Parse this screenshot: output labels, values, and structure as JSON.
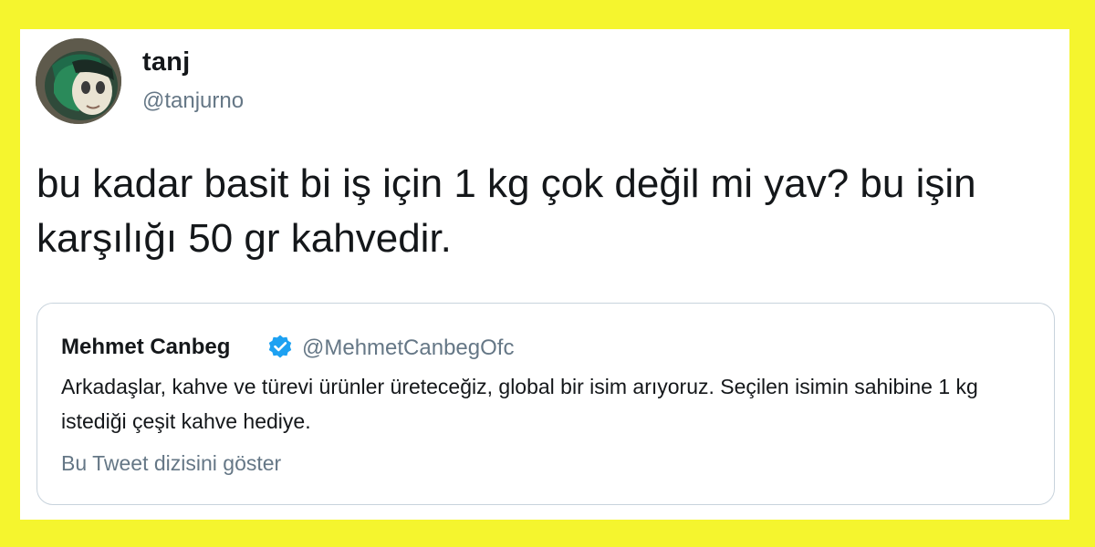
{
  "tweet": {
    "author_name": "tanj",
    "author_handle": "@tanjurno",
    "avatar_icon": "avatar-image",
    "text": "bu kadar basit bi iş için 1 kg çok değil mi yav? bu işin karşılığı 50 gr kahvedir."
  },
  "quoted_tweet": {
    "author_name": "Mehmet Canbeg",
    "verified_icon": "verified-badge-icon",
    "author_handle": "@MehmetCanbegOfc",
    "text": "Arkadaşlar, kahve ve türevi ürünler üreteceğiz, global bir isim arıyoruz. Seçilen isimin sahibine 1 kg istediği çeşit kahve hediye.",
    "thread_link": "Bu Tweet dizisini göster"
  },
  "colors": {
    "background": "#f5f52e",
    "card": "#ffffff",
    "text_primary": "#14171a",
    "text_secondary": "#657786",
    "verified_blue": "#1da1f2",
    "quote_border": "#c8d3dc"
  }
}
